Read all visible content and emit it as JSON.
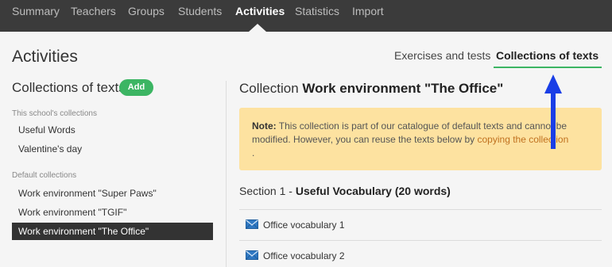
{
  "nav": {
    "items": [
      {
        "label": "Summary",
        "active": false
      },
      {
        "label": "Teachers",
        "active": false
      },
      {
        "label": "Groups",
        "active": false
      },
      {
        "label": "Students",
        "active": false
      },
      {
        "label": "Activities",
        "active": true
      },
      {
        "label": "Statistics",
        "active": false
      },
      {
        "label": "Import",
        "active": false
      }
    ]
  },
  "page": {
    "title": "Activities"
  },
  "subtabs": {
    "exercises": "Exercises and tests",
    "collections": "Collections of texts"
  },
  "sidebar": {
    "heading": "Collections of texts",
    "add_label": "Add",
    "school_group": "This school's collections",
    "school_items": [
      "Useful Words",
      "Valentine's day"
    ],
    "default_group": "Default collections",
    "default_items": [
      "Work environment \"Super Paws\"",
      "Work environment \"TGIF\"",
      "Work environment \"The Office\""
    ]
  },
  "main": {
    "collection_prefix": "Collection",
    "collection_name": "Work environment \"The Office\"",
    "note": {
      "label": "Note:",
      "text": "This collection is part of our catalogue of default texts and cannot be modified. However, you can reuse the texts below by",
      "link": "copying the collection",
      "suffix": "."
    },
    "section": {
      "prefix": "Section 1 -",
      "title": "Useful Vocabulary (20 words)"
    },
    "texts": [
      "Office vocabulary 1",
      "Office vocabulary 2"
    ]
  },
  "colors": {
    "nav_bg": "#3b3b3b",
    "accent_green": "#3cb563",
    "note_bg": "#fde2a0",
    "link_orange": "#c0711f",
    "selected_bg": "#333333",
    "annotation_arrow": "#1a3ee6"
  },
  "icons": {
    "text_item": "envelope-icon",
    "annotation": "arrow-up-icon"
  }
}
